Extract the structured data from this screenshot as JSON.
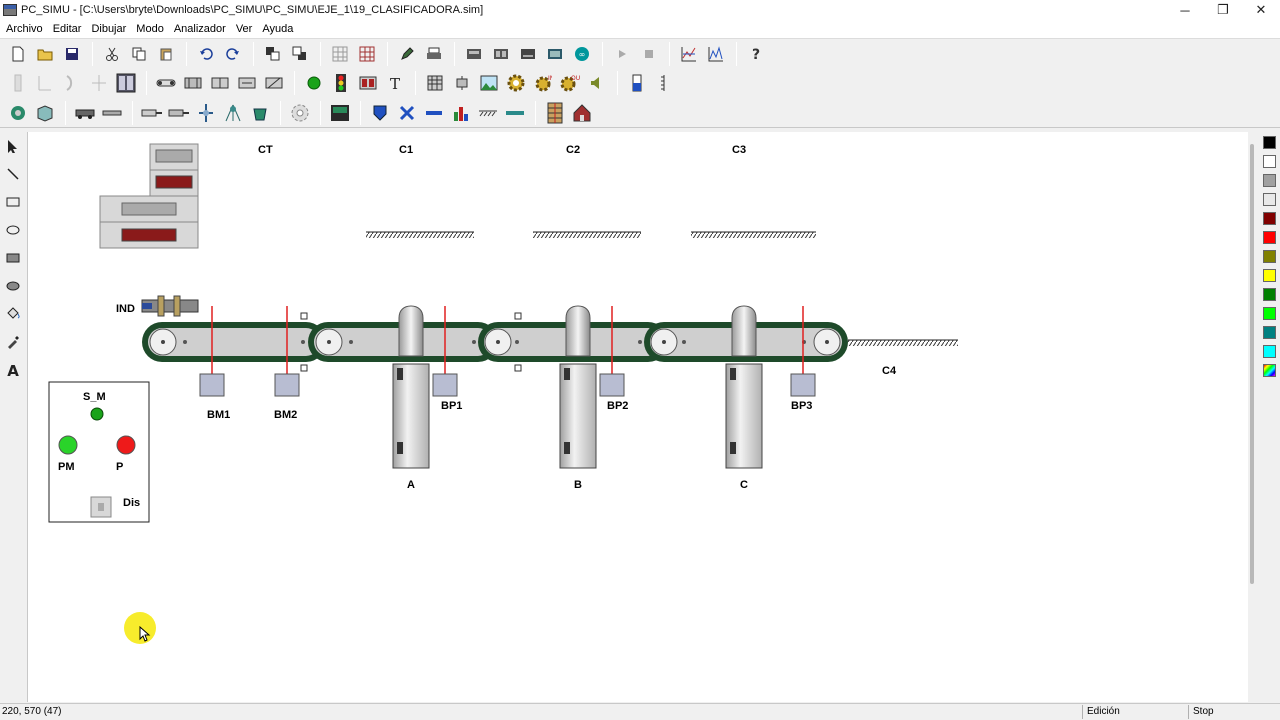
{
  "window": {
    "title": "PC_SIMU - [C:\\Users\\bryte\\Downloads\\PC_SIMU\\PC_SIMU\\EJE_1\\19_CLASIFICADORA.sim]",
    "minimize": "─",
    "maximize": "❐",
    "close": "✕"
  },
  "menu": [
    "Archivo",
    "Editar",
    "Dibujar",
    "Modo",
    "Analizador",
    "Ver",
    "Ayuda"
  ],
  "canvas": {
    "labels": {
      "ct": "CT",
      "c1": "C1",
      "c2": "C2",
      "c3": "C3",
      "c4": "C4",
      "ind": "IND",
      "bm1": "BM1",
      "bm2": "BM2",
      "bp1": "BP1",
      "bp2": "BP2",
      "bp3": "BP3",
      "a": "A",
      "b": "B",
      "c": "C"
    },
    "panel": {
      "s_m": "S_M",
      "pm": "PM",
      "p": "P",
      "dis": "Dis"
    }
  },
  "palette": [
    "#000000",
    "#ffffff",
    "#a0a0a0",
    "#e8e8e8",
    "#800000",
    "#ff0000",
    "#808000",
    "#ffff00",
    "#008000",
    "#00ff00",
    "#008080",
    "#00ffff"
  ],
  "status": {
    "coords": "220, 570 (47)",
    "mode": "Edición",
    "state": "Stop"
  }
}
